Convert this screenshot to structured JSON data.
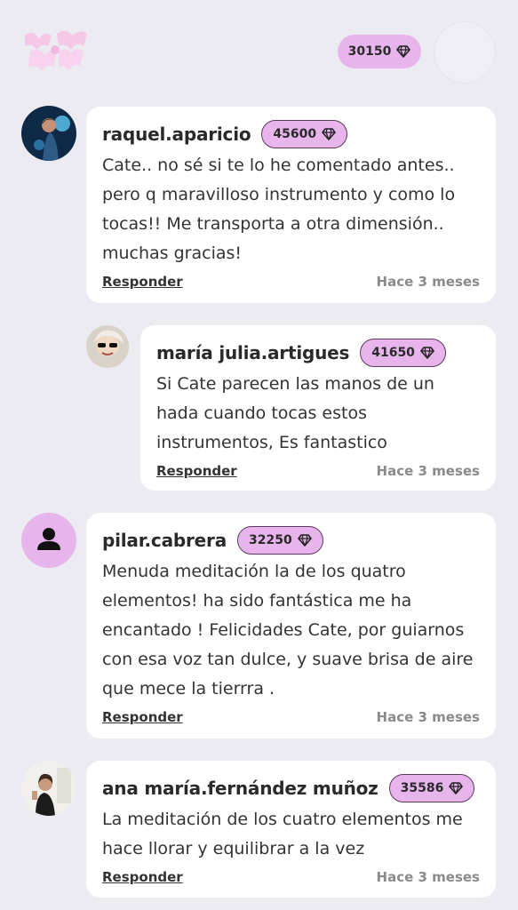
{
  "header": {
    "balance": "30150",
    "gem_icon": "diamond-icon"
  },
  "comments": [
    {
      "username": "raquel.aparicio",
      "score": "45600",
      "text": "Cate.. no sé si te lo he comentado antes.. pero q maravilloso instrumento y como lo tocas!! Me transporta a otra dimensión.. muchas gracias!",
      "reply_label": "Responder",
      "time": "Hace 3 meses"
    },
    {
      "username": "maría julia.artigues",
      "score": "41650",
      "text": "Si Cate parecen las manos de un hada cuando tocas estos instrumentos, Es fantastico",
      "reply_label": "Responder",
      "time": "Hace 3 meses"
    },
    {
      "username": "pilar.cabrera",
      "score": "32250",
      "text": "Menuda meditación la de los quatro elementos! ha sido fantástica me ha encantado ! Felicidades Cate, por guiarnos con esa voz tan dulce,  y suave brisa  de aire que mece la tierrra .",
      "reply_label": "Responder",
      "time": "Hace 3 meses"
    },
    {
      "username": "ana maría.fernández muñoz",
      "score": "35586",
      "text": "La meditación de los cuatro elementos me hace llorar y equilibrar a la vez",
      "reply_label": "Responder",
      "time": "Hace 3 meses"
    }
  ],
  "colors": {
    "background": "#ECEBF2",
    "pill": "#E7B5EC",
    "card": "#FFFFFF"
  }
}
